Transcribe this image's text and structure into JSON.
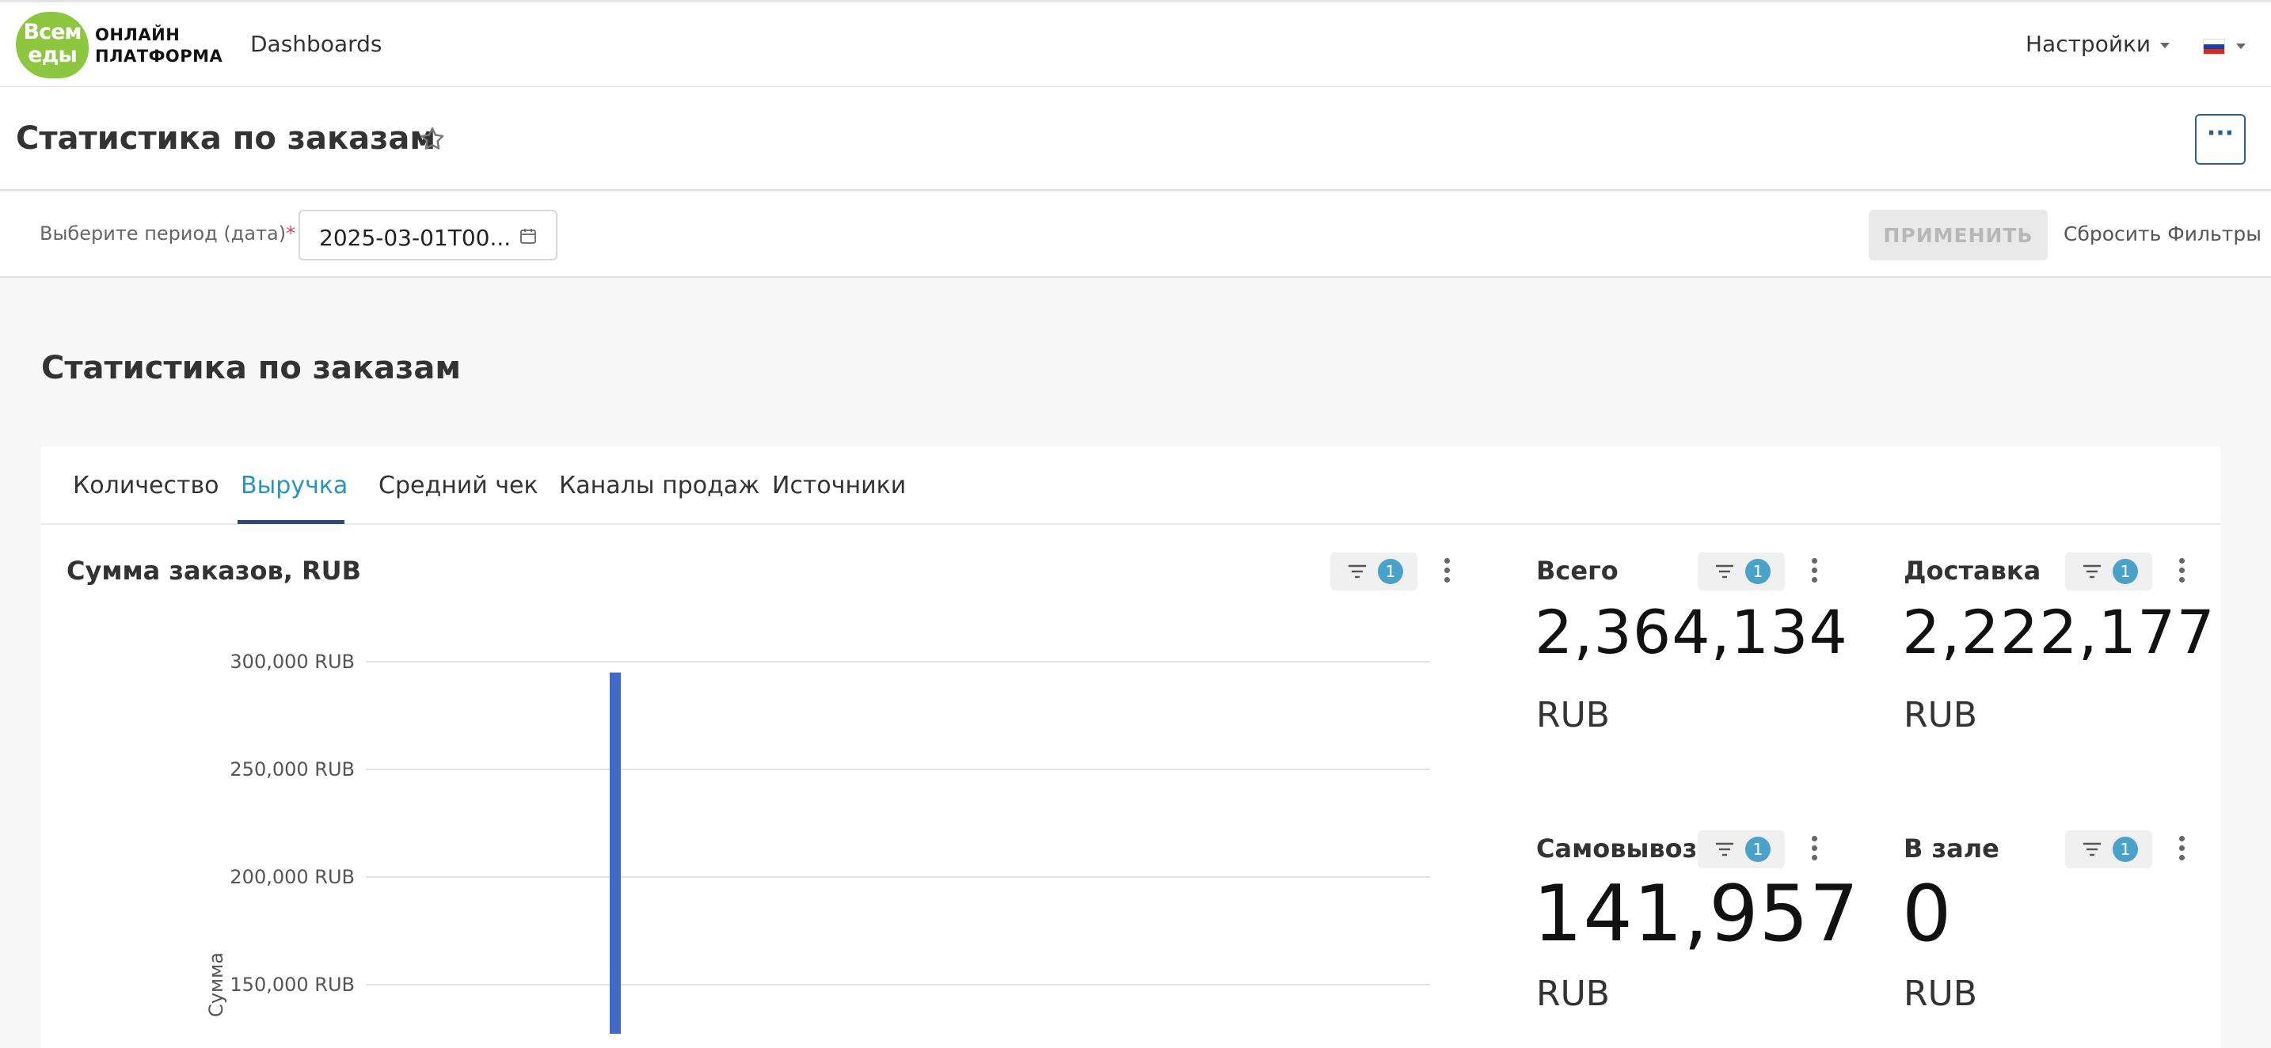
{
  "nav": {
    "logo_blob": "Всем еды",
    "logo_line1": "ОНЛАЙН",
    "logo_line2": "ПЛАТФОРМА",
    "dashboards": "Dashboards",
    "settings": "Настройки",
    "language_icon": "flag-ru-icon"
  },
  "header": {
    "title": "Статистика по заказам",
    "more_label": "···"
  },
  "filters": {
    "period_label": "Выберите период (дата)",
    "required_mark": "*",
    "period_value": "2025-03-01T00...",
    "apply_label": "ПРИМЕНИТЬ",
    "reset_label": "Сбросить Фильтры"
  },
  "dashboard": {
    "title": "Статистика по заказам",
    "tabs": [
      {
        "label": "Количество"
      },
      {
        "label": "Выручка",
        "active": true
      },
      {
        "label": "Средний чек"
      },
      {
        "label": "Каналы продаж"
      },
      {
        "label": "Источники"
      }
    ]
  },
  "chart": {
    "title": "Сумма заказов, RUB",
    "filter_count": "1"
  },
  "chart_data": {
    "type": "bar",
    "title": "Сумма заказов, RUB",
    "ylabel": "Сумма",
    "ylim": [
      0,
      300000
    ],
    "yticks": [
      "150,000 RUB",
      "200,000 RUB",
      "250,000 RUB",
      "300,000 RUB"
    ],
    "ytick_values": [
      150000,
      200000,
      250000,
      300000
    ],
    "grid": true,
    "series": [
      {
        "values": [
          295000
        ]
      }
    ],
    "bar_color": "#4169c8"
  },
  "kpis": {
    "total": {
      "title": "Всего",
      "value": "2,364,134",
      "unit": "RUB",
      "filter_count": "1"
    },
    "delivery": {
      "title": "Доставка",
      "value": "2,222,177",
      "unit": "RUB",
      "filter_count": "1"
    },
    "pickup": {
      "title": "Самовывоз",
      "value": "141,957",
      "unit": "RUB",
      "filter_count": "1"
    },
    "hall": {
      "title": "В зале",
      "value": "0",
      "unit": "RUB",
      "filter_count": "1"
    }
  },
  "colors": {
    "accent": "#2893c4",
    "badge": "#4aa2c9",
    "logo_green": "#8dc63f",
    "required": "#e04355"
  }
}
